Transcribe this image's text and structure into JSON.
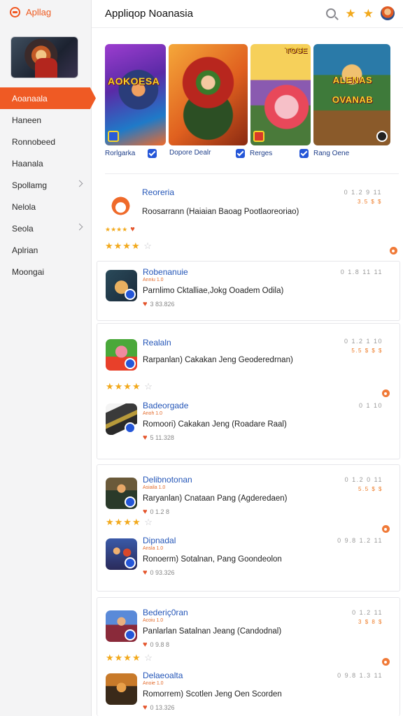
{
  "app": {
    "name": "Apllag",
    "title": "Appliqop Noanasia"
  },
  "sidebar": {
    "items": [
      {
        "label": "Aoanaala",
        "active": true,
        "chevron": false
      },
      {
        "label": "Haneen",
        "chevron": false
      },
      {
        "label": "Ronnobeed",
        "chevron": false
      },
      {
        "label": "Haanala",
        "chevron": false
      },
      {
        "label": "Spollamg",
        "chevron": true
      },
      {
        "label": "Nelola",
        "chevron": false
      },
      {
        "label": "Seola",
        "chevron": true
      },
      {
        "label": "Aplrian",
        "chevron": false
      },
      {
        "label": "Moongai",
        "chevron": false
      }
    ]
  },
  "header": {
    "icons": [
      "search-icon",
      "star-icon",
      "star-icon",
      "user-avatar"
    ]
  },
  "featured": [
    {
      "art_text": "AOKOESA",
      "label": "Rorlgarka"
    },
    {
      "art_text": "",
      "label": "Dopore Dealr"
    },
    {
      "art_text": "TOSE",
      "label": "Rerges"
    },
    {
      "art_text": "ALENAS OVANAB",
      "label": "Rang Oene"
    }
  ],
  "groups": [
    {
      "items": [
        {
          "title": "Reoreria",
          "sub": "",
          "desc": "Roosarrann (Haiaian Baoag Pootlaoreoriao)",
          "likes": "",
          "meta": "0 1.2 9 11",
          "price": "3.5 $ $",
          "rating": "★★★★",
          "rating_empty": "☆",
          "icon": "fox"
        }
      ]
    },
    {
      "items": [
        {
          "title": "Robenanuie",
          "sub": "Anniu  1.0",
          "desc": "Parnlimo Cktalliae,Jokg Ooadem Odila)",
          "likes": "3 83.826",
          "meta": "0 1.8 11 11",
          "price": "",
          "rating": "",
          "icon": "cat"
        }
      ]
    },
    {
      "items": [
        {
          "title": "Realaln",
          "sub": "",
          "desc": "Rarpanlan) Cakakan Jeng Geoderedrnan)",
          "likes": "",
          "meta": "0 1.2 1 10",
          "price": "5.5 $ $ $",
          "rating": "★★★★",
          "rating_empty": "☆",
          "icon": "pig"
        },
        {
          "title": "Badeorgade",
          "sub": "Anoh  1.0",
          "desc": "Romoori) Cakakan Jeng (Roadare Raal)",
          "likes": "5 11.328",
          "meta": "0 1 10",
          "price": "",
          "rating": "",
          "icon": "gun"
        }
      ]
    },
    {
      "items": [
        {
          "title": "Delibnotonan",
          "sub": "Asiaila  1.0",
          "desc": "Raryanlan) Cnataan Pang (Agderedaen)",
          "likes": "0 1.2 8",
          "meta": "0 1.2 0 11",
          "price": "5.5 $ $",
          "rating": "★★★★",
          "rating_empty": "☆",
          "icon": "hero"
        },
        {
          "title": "Dipnadal",
          "sub": "Ansla  1.0",
          "desc": "Ronoerm) Sotalnan, Pang Goondeolon",
          "likes": "0 93.326",
          "meta": "0 9.8 1.2 11",
          "price": "",
          "rating": "",
          "icon": "team"
        }
      ]
    },
    {
      "items": [
        {
          "title": "Bederiç0ran",
          "sub": "Acoiu  1.0",
          "desc": "Panlarlan Satalnan Jeang (Candodnal)",
          "likes": "0 9.8 8",
          "meta": "0 1.2 11",
          "price": "3 $ 8 $",
          "rating": "★★★★",
          "rating_empty": "☆",
          "icon": "girl"
        },
        {
          "title": "Delaeoalta",
          "sub": "Anoie  1.0",
          "desc": "Romorrem) Scotlen Jeng Oen Scorden",
          "likes": "0 13.326",
          "meta": "0 9.8 1.3 11",
          "price": "",
          "rating": "",
          "icon": "war"
        }
      ]
    }
  ]
}
